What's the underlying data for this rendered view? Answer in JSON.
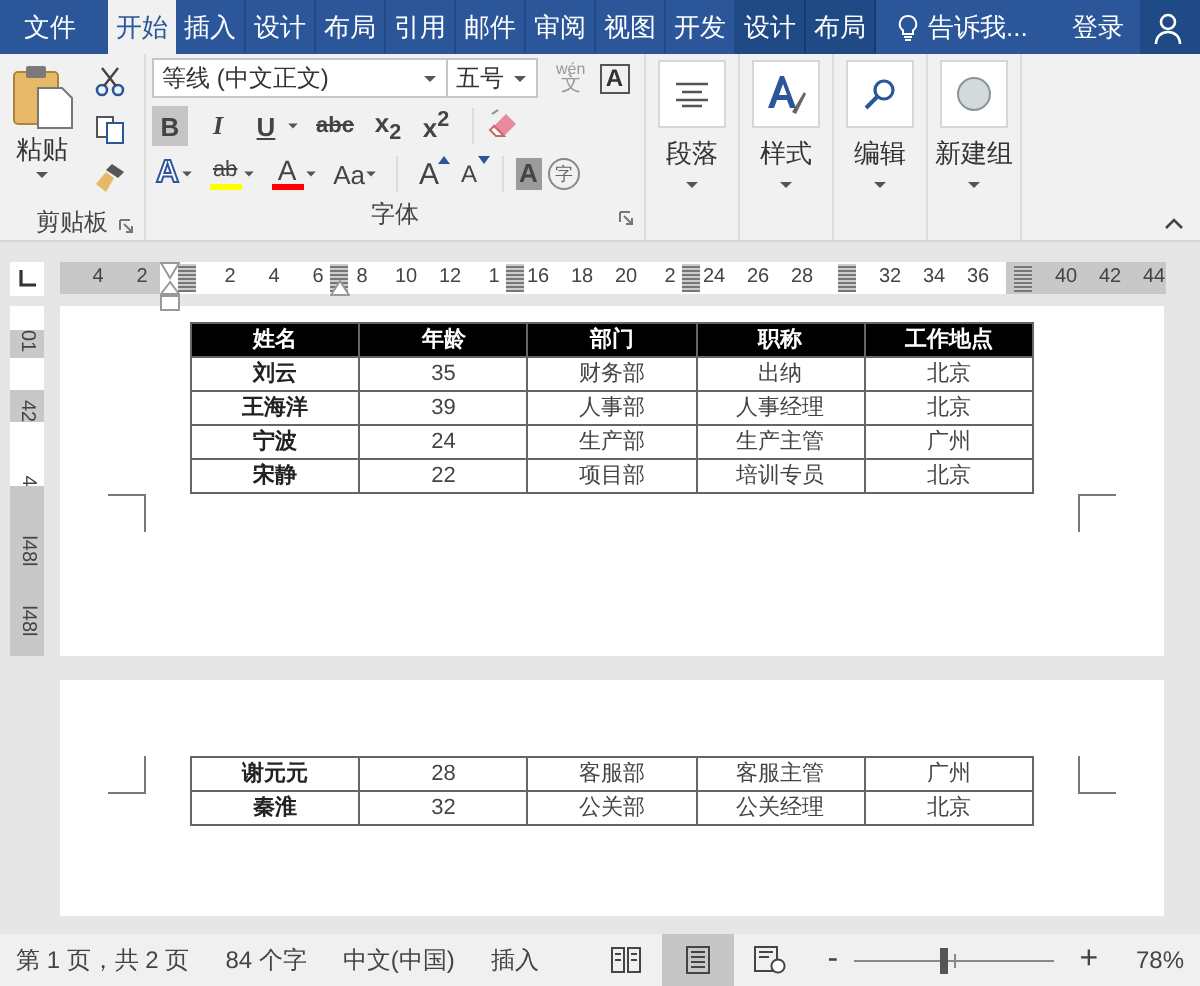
{
  "tabs": [
    {
      "label": "文件",
      "selected": false,
      "kind": "file"
    },
    {
      "label": "开始",
      "selected": true,
      "kind": "main"
    },
    {
      "label": "插入",
      "selected": false,
      "kind": "main"
    },
    {
      "label": "设计",
      "selected": false,
      "kind": "main"
    },
    {
      "label": "布局",
      "selected": false,
      "kind": "main"
    },
    {
      "label": "引用",
      "selected": false,
      "kind": "main"
    },
    {
      "label": "邮件",
      "selected": false,
      "kind": "main"
    },
    {
      "label": "审阅",
      "selected": false,
      "kind": "main"
    },
    {
      "label": "视图",
      "selected": false,
      "kind": "main"
    },
    {
      "label": "开发",
      "selected": false,
      "kind": "main"
    },
    {
      "label": "设计",
      "selected": false,
      "kind": "context"
    },
    {
      "label": "布局",
      "selected": false,
      "kind": "context"
    }
  ],
  "tell_me": "告诉我...",
  "sign_in": "登录",
  "clipboard": {
    "paste": "粘贴",
    "label": "剪贴板"
  },
  "font": {
    "name": "等线 (中文正文)",
    "size": "五号",
    "phonetic_top": "wén",
    "phonetic_bottom": "文",
    "border_char": "A",
    "format_buttons": [
      {
        "label": "B",
        "selected": true
      },
      {
        "label": "I",
        "selected": false
      },
      {
        "label": "U",
        "selected": false
      },
      {
        "label": "abc",
        "selected": false
      },
      {
        "label": "x$_{2}$",
        "selected": false
      },
      {
        "label": "x$^{2}$",
        "selected": false
      }
    ],
    "effects": [
      {
        "kind": "effect",
        "label": "A"
      },
      {
        "kind": "highlight",
        "label": "ab",
        "color": "#ffff00"
      },
      {
        "kind": "fontcolor",
        "label": "A",
        "color": "#ff0000"
      },
      {
        "kind": "case",
        "label": "Aa"
      },
      {
        "kind": "grow",
        "label": "A"
      },
      {
        "kind": "shrink",
        "label": "A"
      },
      {
        "kind": "shading",
        "label": "A"
      },
      {
        "kind": "enclose",
        "label": "字"
      }
    ],
    "label": "字体"
  },
  "groups": [
    {
      "label": "段落",
      "kind": "paragraph"
    },
    {
      "label": "样式",
      "kind": "styles"
    },
    {
      "label": "编辑",
      "kind": "editing"
    },
    {
      "label": "新建组",
      "kind": "new"
    }
  ],
  "ruler": [
    {
      "label": "4"
    },
    {
      "label": "2"
    },
    {
      "kind": "indent"
    },
    {
      "label": "2"
    },
    {
      "label": "4"
    },
    {
      "label": "6"
    },
    {
      "kind": "right-indent"
    },
    {
      "label": "8"
    },
    {
      "label": "10"
    },
    {
      "label": "12"
    },
    {
      "label": "1"
    },
    {
      "kind": "column"
    },
    {
      "label": "16"
    },
    {
      "label": "18"
    },
    {
      "label": "20"
    },
    {
      "label": "2"
    },
    {
      "kind": "column"
    },
    {
      "label": "24"
    },
    {
      "label": "26"
    },
    {
      "label": "28"
    },
    {
      "kind": "margin"
    },
    {
      "label": "32"
    },
    {
      "label": "34"
    },
    {
      "label": "36"
    },
    {
      "kind": "margin"
    },
    {
      "label": "40"
    },
    {
      "label": "42"
    },
    {
      "label": "44"
    }
  ],
  "vertical_ruler": [
    "01",
    "42",
    "4",
    "l48l",
    "l48l"
  ],
  "table": {
    "columns": [
      "姓名",
      "年龄",
      "部门",
      "职称",
      "工作地点"
    ]
  },
  "pages": [
    {
      "rows": [
        [
          "刘云",
          "35",
          "财务部",
          "出纳",
          "北京"
        ],
        [
          "王海洋",
          "39",
          "人事部",
          "人事经理",
          "北京"
        ],
        [
          "宁波",
          "24",
          "生产部",
          "生产主管",
          "广州"
        ],
        [
          "宋静",
          "22",
          "项目部",
          "培训专员",
          "北京"
        ]
      ]
    },
    {
      "rows": [
        [
          "谢元元",
          "28",
          "客服部",
          "客服主管",
          "广州"
        ],
        [
          "秦淮",
          "32",
          "公关部",
          "公关经理",
          "北京"
        ]
      ]
    }
  ],
  "status_bar": {
    "page": "第 1 页，共 2 页",
    "words": "84 个字",
    "language": "中文(中国)",
    "mode": "插入",
    "views": [
      {
        "kind": "read",
        "selected": false
      },
      {
        "kind": "print",
        "selected": true
      },
      {
        "kind": "web",
        "selected": false
      }
    ],
    "zoom_out": "-",
    "zoom_in": "+",
    "zoom": "78%",
    "level": 0.45
  }
}
